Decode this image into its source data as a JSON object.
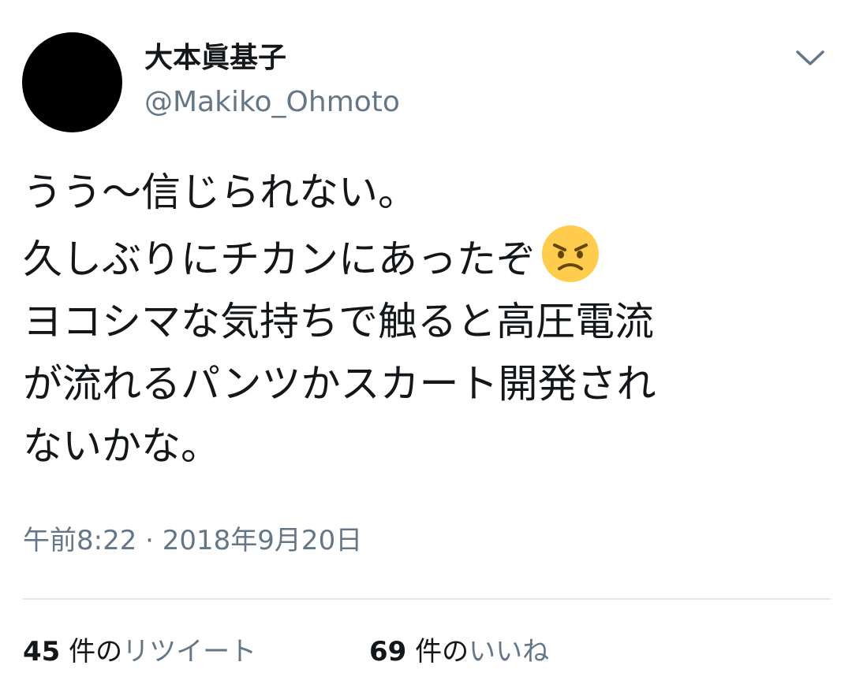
{
  "tweet": {
    "author": {
      "display_name": "大本眞基子",
      "handle": "@Makiko_Ohmoto"
    },
    "menu_icon": "chevron-down-icon",
    "text_lines": [
      "うう〜信じられない。",
      "久しぶりにチカンにあったぞ",
      "ヨコシマな気持ちで触ると高圧電流",
      "が流れるパンツかスカート開発され",
      "ないかな。"
    ],
    "emoji": "angry-face-emoji",
    "timestamp": "午前8:22 · 2018年9月20日",
    "retweets": {
      "count": "45",
      "unit": "件の",
      "label": "リツイート"
    },
    "likes": {
      "count": "69",
      "unit": "件の",
      "label": "いいね"
    }
  },
  "colors": {
    "text_primary": "#14171a",
    "text_secondary": "#657786",
    "divider": "#e1e8ed",
    "emoji_face": "#ffcc4d",
    "emoji_features": "#664500"
  }
}
